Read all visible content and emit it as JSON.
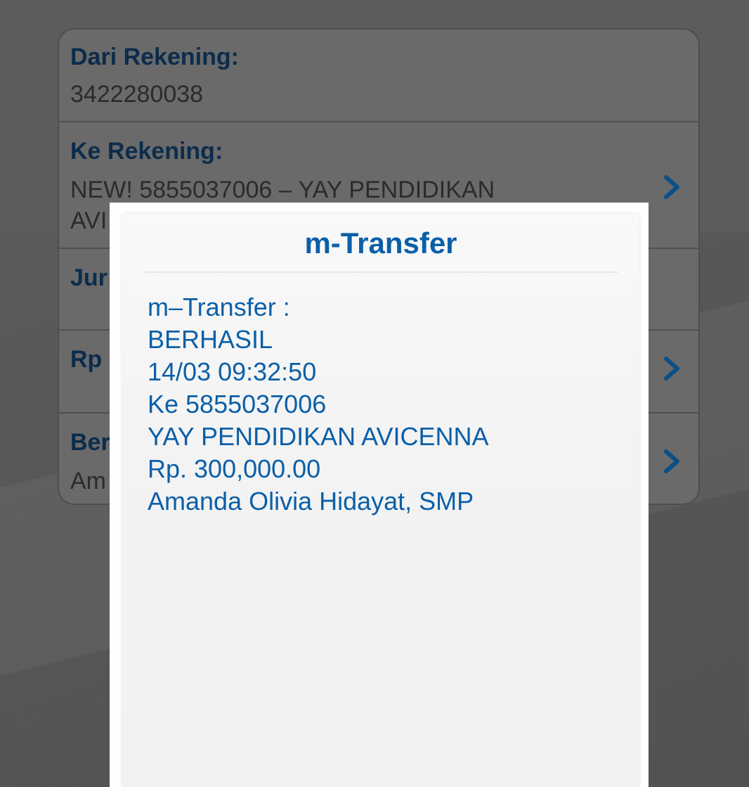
{
  "form": {
    "from_label": "Dari Rekening:",
    "from_value": "3422280038",
    "to_label": "Ke Rekening:",
    "to_value_line1": "NEW! 5855037006 – YAY PENDIDIKAN",
    "to_value_line2": "AVI",
    "jumlah_label": "Jur",
    "rp_label": "Rp",
    "ber_label": "Ber",
    "ber_value": "Am"
  },
  "dialog": {
    "title": "m-Transfer",
    "lines": [
      "m–Transfer :",
      "BERHASIL",
      "14/03 09:32:50",
      "Ke 5855037006",
      "YAY PENDIDIKAN AVICENNA",
      "Rp. 300,000.00",
      "Amanda Olivia Hidayat, SMP"
    ]
  },
  "icons": {
    "row_chevron": "chevron-right-icon"
  },
  "colors": {
    "accent_blue": "#0b5fa8",
    "label_navy": "#0c2c4c",
    "overlay_gray": "#5a5a5a"
  }
}
